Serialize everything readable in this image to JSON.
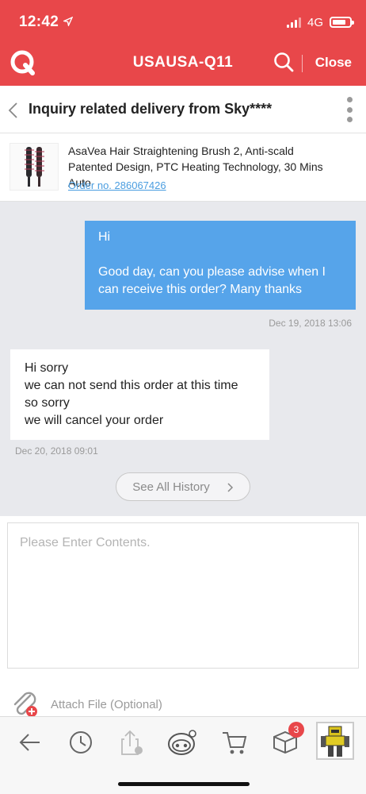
{
  "status_bar": {
    "time": "12:42",
    "network": "4G"
  },
  "appbar": {
    "title": "USAUSA-Q11",
    "close_label": "Close",
    "logo_icon": "q-logo-icon",
    "search_icon": "search-icon"
  },
  "subheader": {
    "title": "Inquiry related delivery from Sky****",
    "back_icon": "chevron-left-icon",
    "more_icon": "more-vertical-icon"
  },
  "product": {
    "name": "AsaVea Hair Straightening Brush 2, Anti-scald Patented Design, PTC Heating Technology, 30 Mins Auto",
    "order_link": "Order no. 286067426"
  },
  "messages": [
    {
      "direction": "outgoing",
      "text": "Hi\n\nGood day, can you please advise when I can receive this order? Many thanks",
      "timestamp": "Dec 19, 2018 13:06"
    },
    {
      "direction": "incoming",
      "text": "Hi sorry\nwe can not send this order at this time\nso sorry\nwe will cancel your order",
      "timestamp": "Dec 20, 2018 09:01"
    }
  ],
  "history_button": {
    "label": "See All History"
  },
  "composer": {
    "placeholder": "Please Enter Contents.",
    "value": ""
  },
  "attach": {
    "label": "Attach File (Optional)"
  },
  "bottom_bar": {
    "tabs": [
      {
        "icon": "arrow-left-icon"
      },
      {
        "icon": "clock-icon"
      },
      {
        "icon": "share-upload-icon"
      },
      {
        "icon": "robot-chat-icon"
      },
      {
        "icon": "cart-icon"
      },
      {
        "icon": "box-icon",
        "badge": "3"
      },
      {
        "icon": "avatar-robot"
      }
    ]
  },
  "colors": {
    "brand_red": "#e8474a",
    "bubble_blue": "#56a4ea",
    "chat_bg": "#e8e9ed",
    "link_blue": "#4a9de0"
  }
}
